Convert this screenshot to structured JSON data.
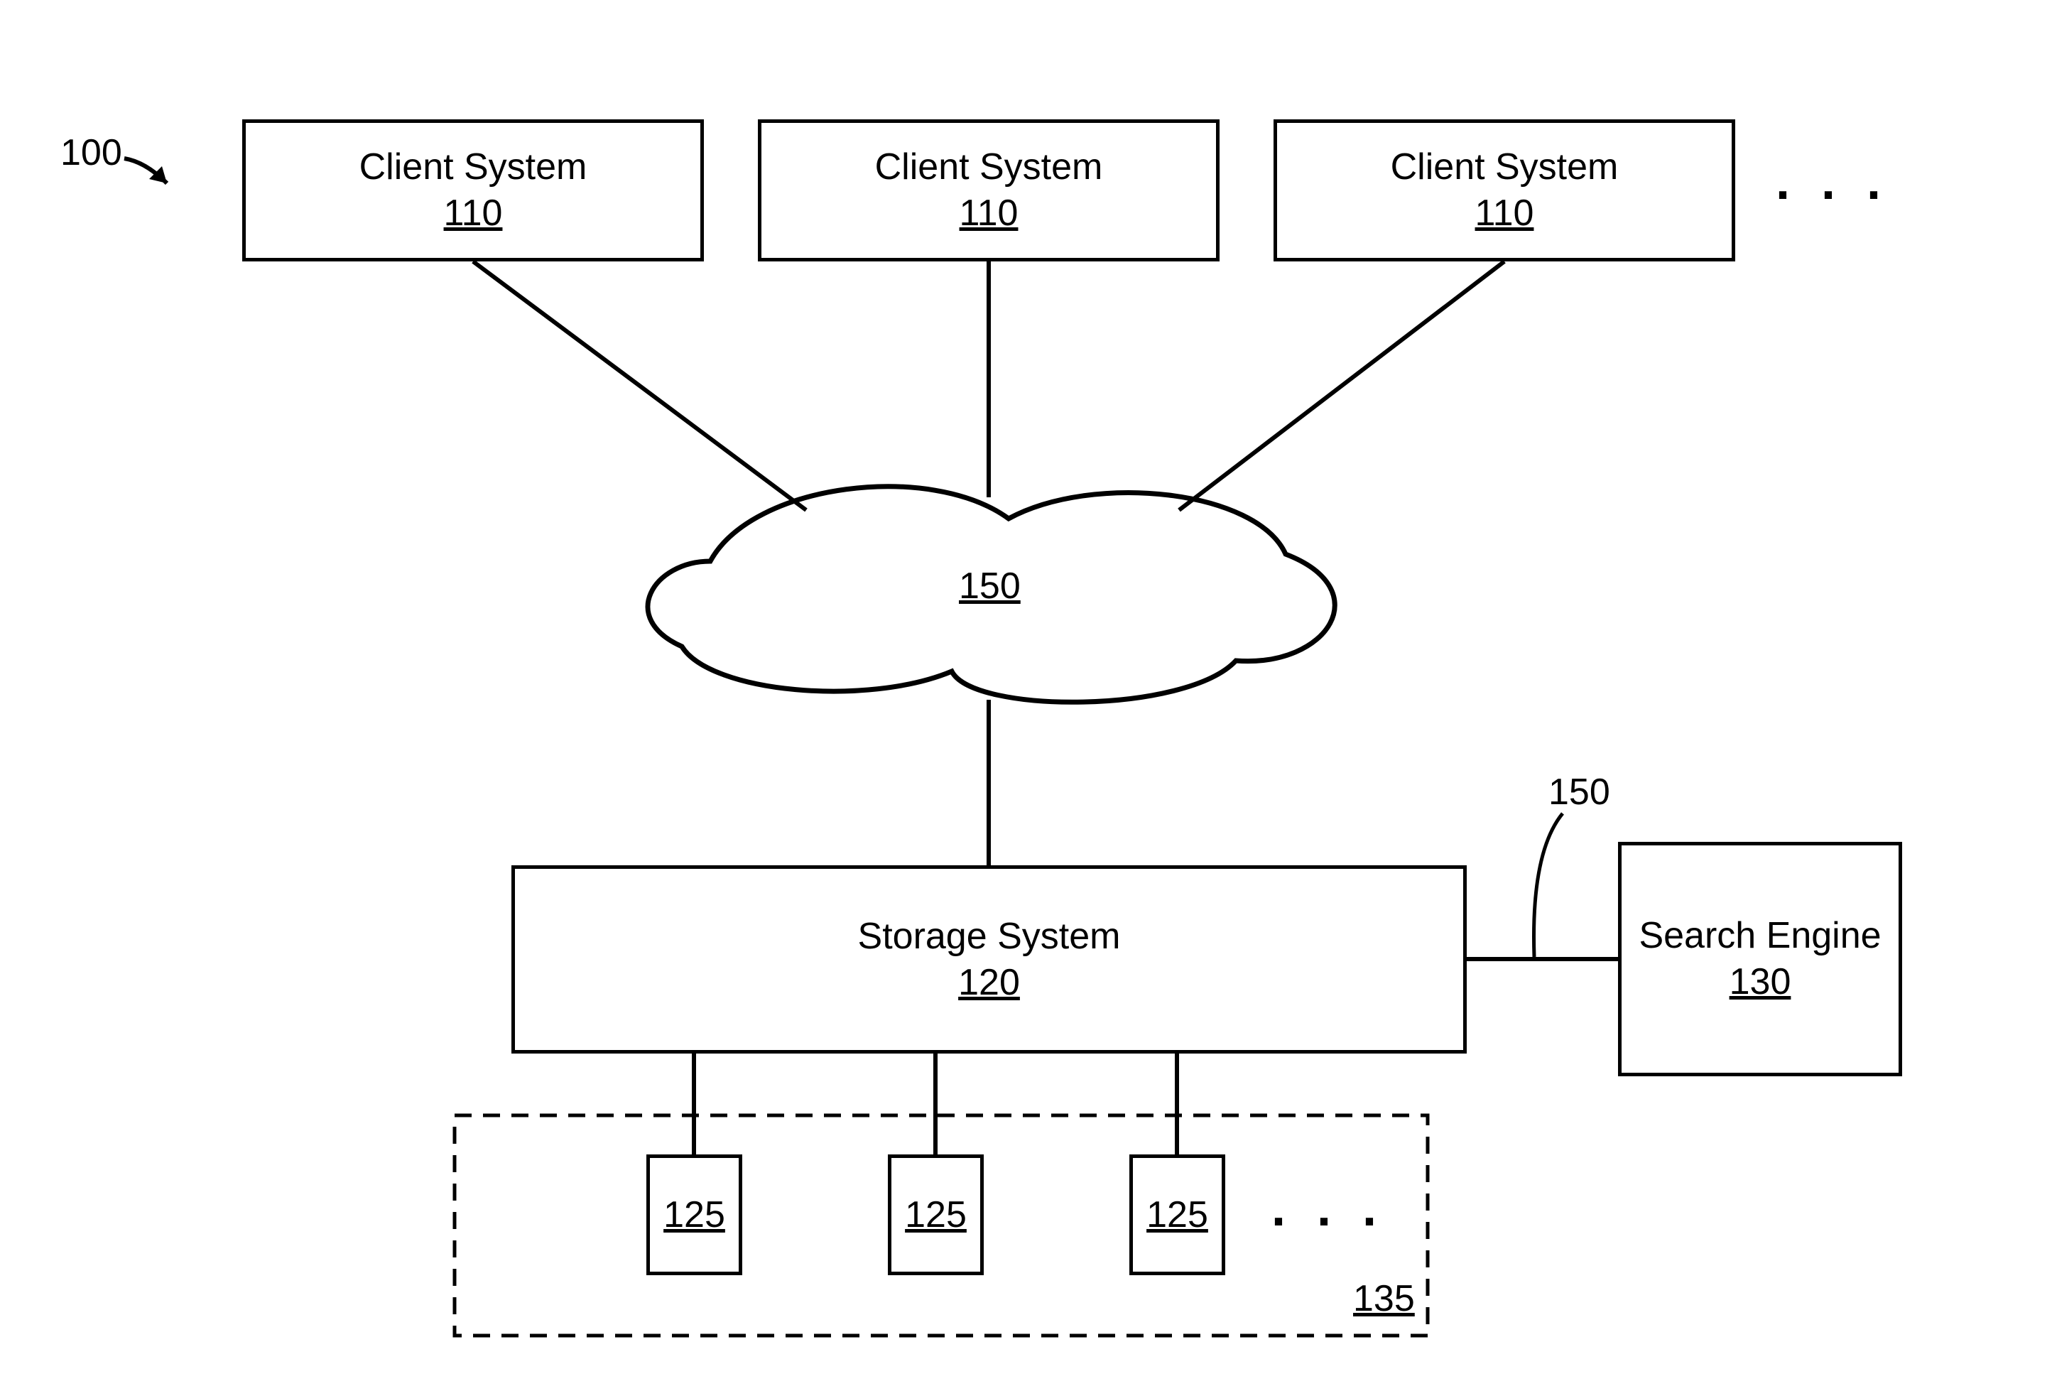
{
  "figure_ref": "100",
  "top_ellipsis": ". . .",
  "bottom_ellipsis": ". . .",
  "clients": {
    "a": {
      "title": "Client System",
      "num": "110"
    },
    "b": {
      "title": "Client System",
      "num": "110"
    },
    "c": {
      "title": "Client System",
      "num": "110"
    }
  },
  "cloud": {
    "num": "150"
  },
  "storage": {
    "title": "Storage System",
    "num": "120"
  },
  "search": {
    "title": "Search Engine",
    "num": "130"
  },
  "connector_label": "150",
  "stores": {
    "a": {
      "num": "125"
    },
    "b": {
      "num": "125"
    },
    "c": {
      "num": "125"
    }
  },
  "store_group": {
    "num": "135"
  }
}
